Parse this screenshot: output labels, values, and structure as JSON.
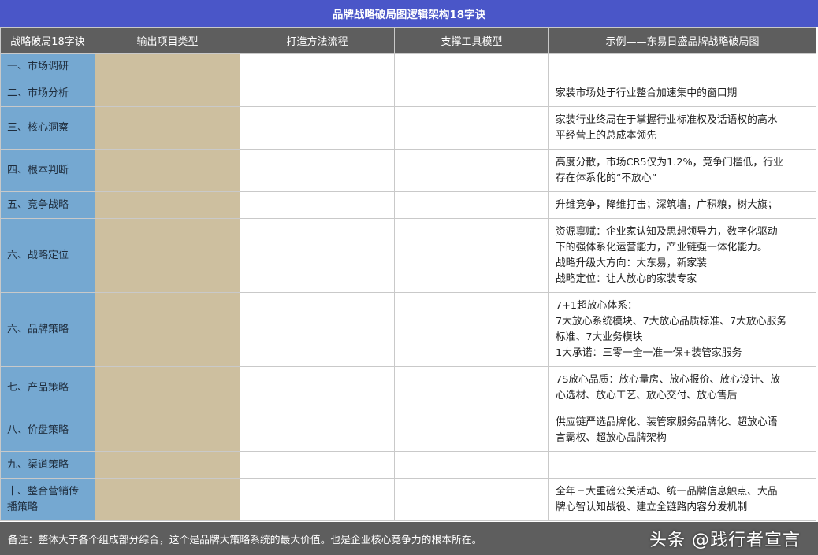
{
  "title": "品牌战略破局图逻辑架构18字诀",
  "headers": [
    "战略破局18字诀",
    "输出项目类型",
    "打造方法流程",
    "支撑工具模型",
    "示例——东易日盛品牌战略破局图"
  ],
  "rows": [
    {
      "stage": "一、市场调研",
      "example": ""
    },
    {
      "stage": "二、市场分析",
      "example": "家装市场处于行业整合加速集中的窗口期"
    },
    {
      "stage": "三、核心洞察",
      "example": "家装行业终局在于掌握行业标准权及话语权的高水\n平经营上的总成本领先"
    },
    {
      "stage": "四、根本判断",
      "example": "高度分散，市场CR5仅为1.2%，竞争门槛低，行业\n存在体系化的“不放心”"
    },
    {
      "stage": "五、竞争战略",
      "example": "升维竞争，降维打击；深筑墙，广积粮，树大旗；"
    },
    {
      "stage": "六、战略定位",
      "example": "资源禀赋：企业家认知及思想领导力，数字化驱动\n下的强体系化运营能力，产业链强一体化能力。\n战略升级大方向：大东易，新家装\n战略定位：让人放心的家装专家"
    },
    {
      "stage": "六、品牌策略",
      "example": "7+1超放心体系：\n7大放心系统模块、7大放心品质标准、7大放心服务\n标准、7大业务模块\n1大承诺：三零一全一准一保+装管家服务"
    },
    {
      "stage": "七、产品策略",
      "example": "7S放心品质：放心量房、放心报价、放心设计、放\n心选材、放心工艺、放心交付、放心售后"
    },
    {
      "stage": "八、价盘策略",
      "example": "供应链严选品牌化、装管家服务品牌化、超放心语\n言霸权、超放心品牌架构"
    },
    {
      "stage": "九、渠道策略",
      "example": ""
    },
    {
      "stage": "十、整合营销传\n播策略",
      "example": "全年三大重磅公关活动、统一品牌信息触点、大品\n牌心智认知战役、建立全链路内容分发机制"
    }
  ],
  "note": "备注：整体大于各个组成部分综合，这个是品牌大策略系统的最大价值。也是企业核心竞争力的根本所在。",
  "watermark": "头条 @践行者宣言",
  "colors": {
    "title_bg": "#4a56c8",
    "header_bg": "#5e5e5e",
    "stage_bg": "#75a8d1",
    "output_bg": "#cdbf9f",
    "note_bg": "#5e5e5e"
  }
}
